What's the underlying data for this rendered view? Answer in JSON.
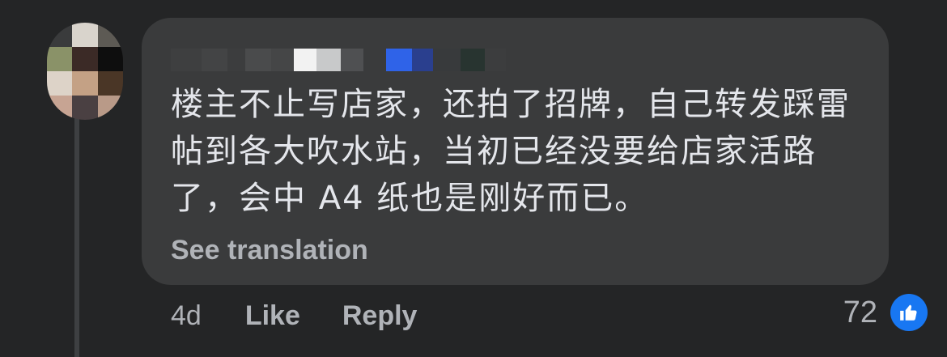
{
  "comment": {
    "text": "楼主不止写店家，还拍了招牌，自己转发踩雷帖到各大吹水站，当初已经没要给店家活路了，会中 A4 纸也是刚好而已。",
    "see_translation_label": "See translation"
  },
  "actions": {
    "time": "4d",
    "like_label": "Like",
    "reply_label": "Reply"
  },
  "reactions": {
    "count": "72",
    "icon": "thumbs-up-icon",
    "badge_color": "#1877f2"
  },
  "colors": {
    "background": "#242526",
    "bubble": "#3a3b3c",
    "primary_text": "#e4e6eb",
    "secondary_text": "#b0b3b8"
  }
}
